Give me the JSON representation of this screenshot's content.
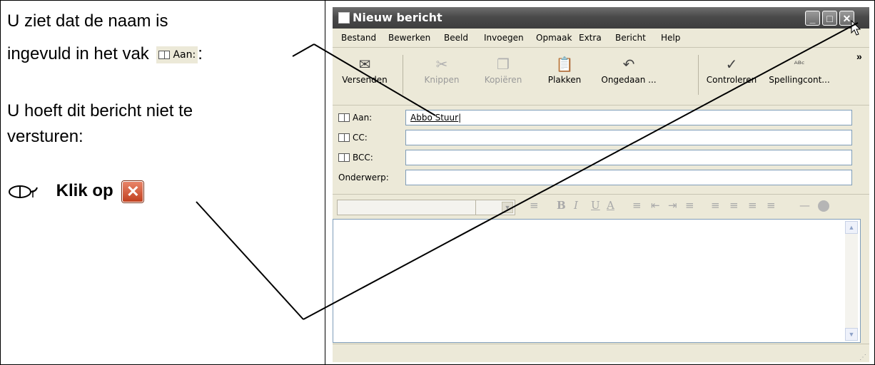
{
  "instructions": {
    "line1": "U ziet dat de naam is",
    "line2_prefix": "ingevuld in het vak",
    "aan_chip_label": "Aan:",
    "line2_suffix": ":",
    "line3": "U hoeft dit bericht niet te",
    "line4": "versturen:",
    "action_prefix": "Klik op",
    "close_glyph": "✕",
    "mouse_icon": "mouse-icon"
  },
  "window": {
    "title": "Nieuw bericht",
    "controls": {
      "minimize": "_",
      "maximize": "□",
      "close": "✕"
    },
    "menu": [
      "Bestand",
      "Bewerken",
      "Beeld",
      "Invoegen",
      "Opmaak",
      "Extra",
      "Bericht",
      "Help"
    ],
    "toolbar": [
      {
        "label": "Versenden",
        "glyph": "✉",
        "enabled": true
      },
      {
        "label": "Knippen",
        "glyph": "✂",
        "enabled": false
      },
      {
        "label": "Kopiëren",
        "glyph": "❐",
        "enabled": false
      },
      {
        "label": "Plakken",
        "glyph": "📋",
        "enabled": true
      },
      {
        "label": "Ongedaan ...",
        "glyph": "↶",
        "enabled": true
      },
      {
        "label": "Controleren",
        "glyph": "✓",
        "enabled": true
      },
      {
        "label": "Spellingcont...",
        "glyph": "ᴬᴮᶜ",
        "enabled": true
      }
    ],
    "toolbar_overflow": "»",
    "fields": {
      "to_label": "Aan:",
      "to_value": "Abbo Stuur",
      "cc_label": "CC:",
      "cc_value": "",
      "bcc_label": "BCC:",
      "bcc_value": "",
      "subject_label": "Onderwerp:",
      "subject_value": ""
    },
    "format_buttons": [
      "B",
      "I",
      "U",
      "A",
      "≡",
      "≡",
      "⇤",
      "⇥",
      "≡",
      "≡",
      "≡",
      "≡",
      "—"
    ],
    "scroll_up": "▲",
    "scroll_down": "▼"
  }
}
